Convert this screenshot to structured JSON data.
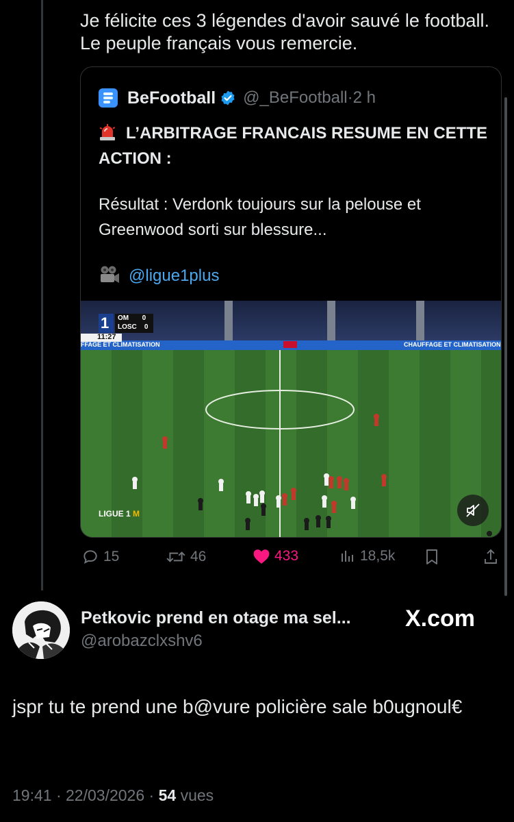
{
  "parent_tweet": {
    "text": "Je félicite ces 3 légendes d'avoir sauvé le football. Le peuple français vous remercie."
  },
  "quoted_tweet": {
    "author_name": "BeFootball",
    "author_handle": "@_BeFootball",
    "separator": "·",
    "time": "2 h",
    "line1": "L’ARBITRAGE FRANCAIS RESUME EN CETTE ACTION :",
    "line2": "Résultat : Verdonk toujours sur la pelouse et Greenwood sorti sur blessure...",
    "credit_link": "@ligue1plus",
    "icons": {
      "logo": "befootball-logo-icon",
      "verified": "verified-badge-icon",
      "siren": "siren-icon",
      "camera": "movie-camera-icon",
      "mute": "mute-icon"
    },
    "video": {
      "scoreboard": {
        "team1": "OM",
        "score1": "0",
        "team2": "LOSC",
        "score2": "0",
        "clock": "11:27"
      },
      "ad_left": "FFAGE ET CLIMATISATION",
      "ad_right": "CHAUFFAGE ET CLIMATISATION",
      "watermark": "LIGUE 1"
    }
  },
  "actions": {
    "replies": "15",
    "reposts": "46",
    "likes": "433",
    "views": "18,5k",
    "icons": [
      "reply-icon",
      "repost-icon",
      "heart-icon",
      "views-icon",
      "bookmark-icon",
      "share-icon"
    ]
  },
  "reply_tweet": {
    "author_name": "Petkovic prend en otage ma sel...",
    "author_handle": "@arobazclxshv6",
    "brand": "X.com",
    "text": "jspr tu te prend une b@vure policière sale b0ugnoul€",
    "time": "19:41",
    "date": "22/03/2026",
    "separator": "·",
    "views_count": "54",
    "views_label": "vues"
  },
  "colors": {
    "background": "#000000",
    "text": "#e7e9ea",
    "muted": "#71767b",
    "link": "#4aa8f0",
    "like": "#f91880",
    "verified": "#1d9bf0",
    "border": "#2f3336"
  }
}
